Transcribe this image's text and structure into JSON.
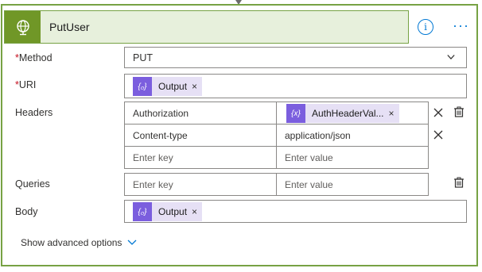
{
  "action": {
    "title": "PutUser",
    "info_label": "i",
    "more_label": "···"
  },
  "method": {
    "label": "Method",
    "required_mark": "*",
    "value": "PUT"
  },
  "uri": {
    "label": "URI",
    "required_mark": "*",
    "token": {
      "icon_text": "{₀}",
      "label": "Output",
      "remove": "×"
    }
  },
  "headers": {
    "label": "Headers",
    "rows": [
      {
        "key": "Authorization",
        "value_token": {
          "icon_text": "{x}",
          "label": "AuthHeaderVal...",
          "remove": "×"
        }
      },
      {
        "key": "Content-type",
        "value": "application/json"
      },
      {
        "key_placeholder": "Enter key",
        "value_placeholder": "Enter value"
      }
    ]
  },
  "queries": {
    "label": "Queries",
    "key_placeholder": "Enter key",
    "value_placeholder": "Enter value"
  },
  "body": {
    "label": "Body",
    "token": {
      "icon_text": "{₀}",
      "label": "Output",
      "remove": "×"
    }
  },
  "advanced": {
    "label": "Show advanced options"
  },
  "colors": {
    "accent_green": "#709727",
    "header_bg": "#e7f0dc",
    "token_purple": "#7b5ede",
    "token_bg": "#e6e0f5",
    "link_blue": "#0078d4",
    "required_red": "#c50f1f"
  },
  "icons": {
    "header": "globe-icon",
    "info": "info-icon",
    "more": "ellipsis-icon",
    "method_dropdown": "chevron-down-icon",
    "delete_row": "close-icon",
    "delete_all": "trash-icon",
    "advanced": "chevron-down-icon"
  }
}
